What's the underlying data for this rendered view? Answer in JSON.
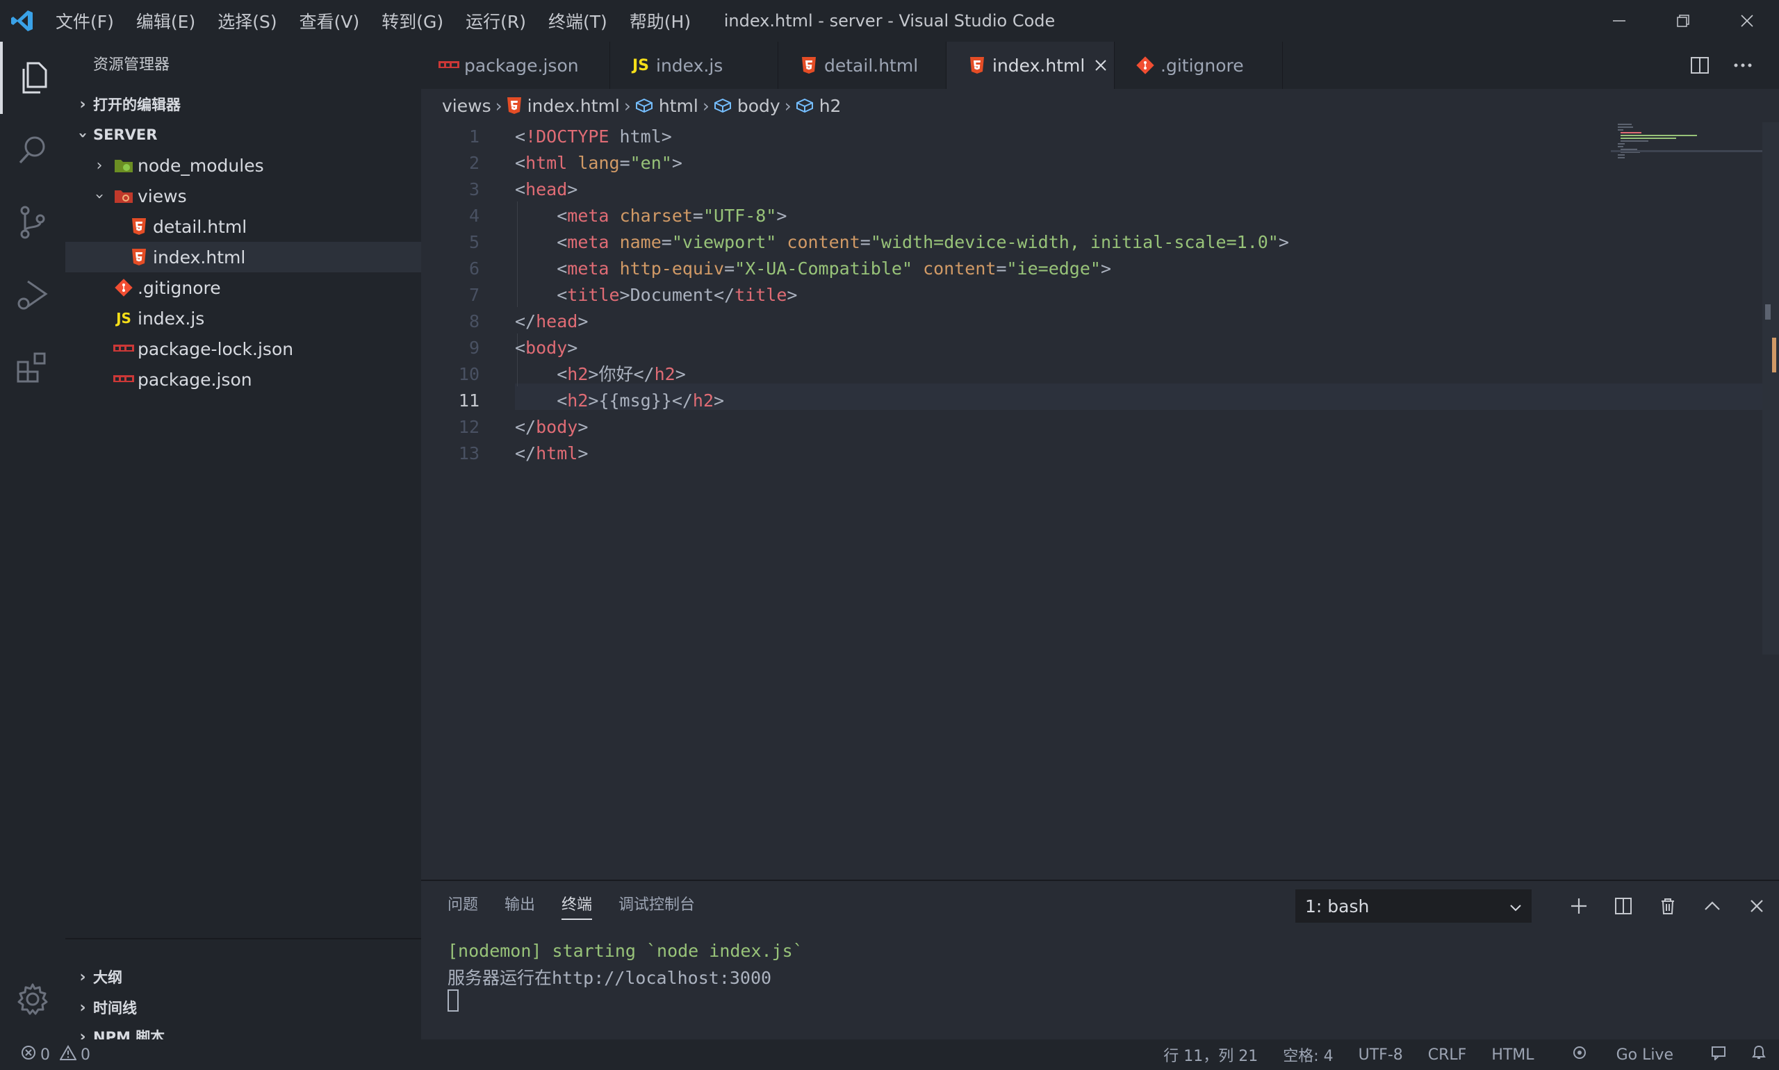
{
  "window": {
    "title": "index.html - server - Visual Studio Code",
    "menu": [
      "文件(F)",
      "编辑(E)",
      "选择(S)",
      "查看(V)",
      "转到(G)",
      "运行(R)",
      "终端(T)",
      "帮助(H)"
    ]
  },
  "sidebar": {
    "title": "资源管理器",
    "open_editors": "打开的编辑器",
    "project": "SERVER",
    "tree": [
      {
        "label": "node_modules",
        "icon": "node-folder-icon"
      },
      {
        "label": "views",
        "icon": "views-folder-icon"
      },
      {
        "label": "detail.html",
        "icon": "html5-icon"
      },
      {
        "label": "index.html",
        "icon": "html5-icon"
      },
      {
        "label": ".gitignore",
        "icon": "git-icon"
      },
      {
        "label": "index.js",
        "icon": "js-icon",
        "badge": "JS"
      },
      {
        "label": "package-lock.json",
        "icon": "npm-icon"
      },
      {
        "label": "package.json",
        "icon": "npm-icon"
      }
    ],
    "outline": "大纲",
    "timeline": "时间线",
    "npm_scripts": "NPM 脚本"
  },
  "tabs": [
    {
      "label": "package.json",
      "icon": "npm-icon"
    },
    {
      "label": "index.js",
      "icon": "js-icon",
      "badge": "JS"
    },
    {
      "label": "detail.html",
      "icon": "html5-icon"
    },
    {
      "label": "index.html",
      "icon": "html5-icon",
      "active": true
    },
    {
      "label": ".gitignore",
      "icon": "git-icon"
    }
  ],
  "breadcrumb": [
    "views",
    "index.html",
    "html",
    "body",
    "h2"
  ],
  "editor": {
    "line_numbers": [
      "1",
      "2",
      "3",
      "4",
      "5",
      "6",
      "7",
      "8",
      "9",
      "10",
      "11",
      "12",
      "13"
    ],
    "lines": [
      "<!DOCTYPE html>",
      "<html lang=\"en\">",
      "<head>",
      "    <meta charset=\"UTF-8\">",
      "    <meta name=\"viewport\" content=\"width=device-width, initial-scale=1.0\">",
      "    <meta http-equiv=\"X-UA-Compatible\" content=\"ie=edge\">",
      "    <title>Document</title>",
      "</head>",
      "<body>",
      "    <h2>你好</h2>",
      "    <h2>{{msg}}</h2>",
      "</body>",
      "</html>"
    ]
  },
  "panel": {
    "tabs": [
      "问题",
      "输出",
      "终端",
      "调试控制台"
    ],
    "active_tab": "终端",
    "terminal_select": "1: bash",
    "terminal_lines": [
      "[nodemon] starting `node index.js`",
      "服务器运行在http://localhost:3000"
    ]
  },
  "statusbar": {
    "errors": "0",
    "warnings": "0",
    "position": "行 11，列 21",
    "spaces": "空格: 4",
    "encoding": "UTF-8",
    "eol": "CRLF",
    "language": "HTML",
    "golive": "Go Live"
  },
  "colors": {
    "accent": "#007acc",
    "html5": "#e44d26",
    "js": "#f5de19",
    "npm": "#cb3837",
    "git": "#f14e32"
  }
}
